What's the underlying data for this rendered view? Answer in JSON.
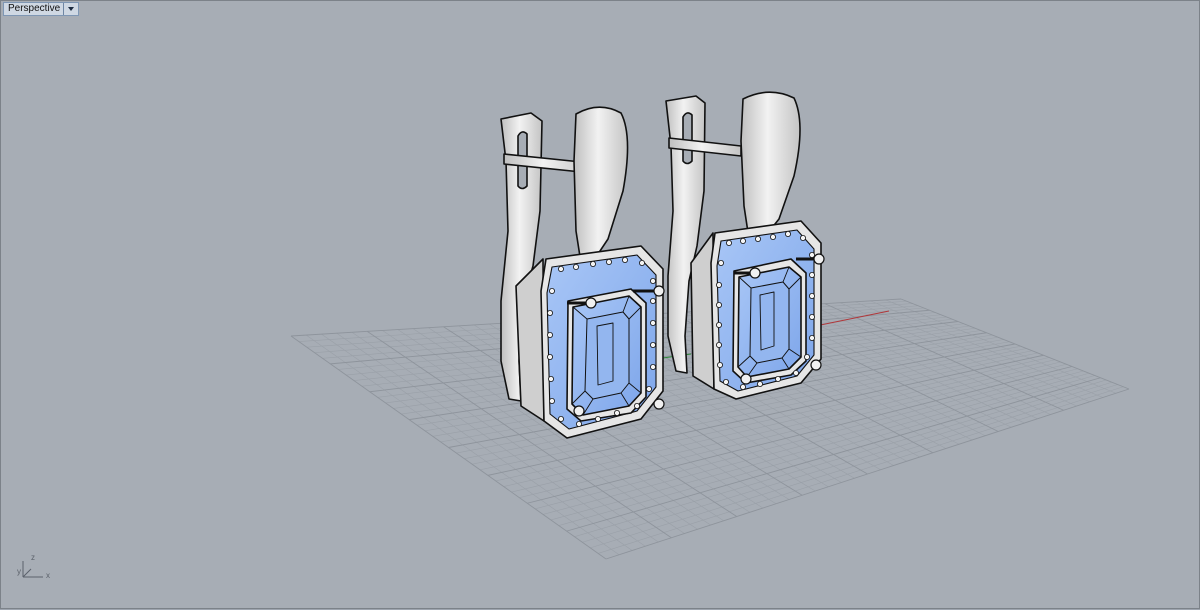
{
  "viewport": {
    "name": "Perspective",
    "grid_visible": true,
    "axes_indicator": {
      "z_label": "z",
      "y_label": "y",
      "x_label": "x"
    }
  },
  "model": {
    "objects": [
      "earring-left",
      "earring-right"
    ],
    "gem_color": "#8fb4f0",
    "metal_color": "#d9d9d9"
  }
}
